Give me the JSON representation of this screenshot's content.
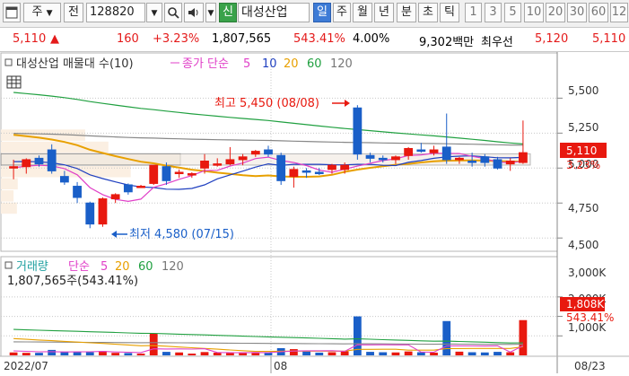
{
  "toolbar": {
    "window_icon": "window-icon",
    "market_label": "주",
    "jeon_label": "전",
    "code_value": "128820",
    "sin_label": "신",
    "company_name": "대성산업",
    "period_tabs": [
      "일",
      "주",
      "월",
      "년",
      "분",
      "초",
      "틱"
    ],
    "selected_period": "일",
    "interval_buttons": [
      "1",
      "3",
      "5",
      "10",
      "20",
      "30",
      "60",
      "12"
    ]
  },
  "quote": {
    "price": "5,110",
    "change_arrow": "▲",
    "change": "160",
    "change_pct": "+3.23%",
    "volume": "1,807,565",
    "volume_ratio": "543.41%",
    "rate": "4.00%",
    "amount": "9,302백만",
    "best_ask_label": "최우선",
    "best_ask": "5,120",
    "best_bid": "5,110"
  },
  "price_panel": {
    "legend_title": "대성산업 매물대 수(10)",
    "legend_ma": "종가 단순",
    "legend_periods": [
      "5",
      "10",
      "20",
      "60",
      "120"
    ],
    "high_label": "최고 5,450 (08/08)",
    "low_label": "최저 4,580 (07/15)",
    "y_ticks": [
      "5,500",
      "5,250",
      "5,000",
      "4,750",
      "4,500"
    ],
    "current_price_tag": "5,110",
    "current_pct_tag": "3.23%"
  },
  "volume_panel": {
    "legend_title": "거래량",
    "legend_ma": "단순",
    "legend_periods": [
      "5",
      "20",
      "60",
      "120"
    ],
    "volume_text": "1,807,565주(543.41%)",
    "y_ticks": [
      "3,000K",
      "2,000K",
      "1,000K"
    ],
    "current_volume_tag": "1,808K",
    "current_pct_tag": "543.41%"
  },
  "x_axis": {
    "labels": [
      "2022/07",
      "08",
      "08/23"
    ]
  },
  "colors": {
    "up": "#e8190f",
    "down": "#1a5fc8",
    "ma5": "#e040c8",
    "ma10": "#2040c0",
    "ma20": "#e8a000",
    "ma60": "#20a040",
    "ma120": "#888888",
    "tag_bg": "#e8190f",
    "grid": "#c8c8c8"
  },
  "chart_data": {
    "type": "candlestick",
    "price_axis": {
      "ylim": [
        4450,
        5650
      ],
      "ticks": [
        4500,
        4750,
        5000,
        5250,
        5500
      ]
    },
    "volume_axis": {
      "ylim": [
        0,
        3500
      ],
      "unit": "K",
      "ticks": [
        1000,
        2000,
        3000
      ]
    },
    "candles": [
      {
        "o": 5000,
        "h": 5060,
        "l": 4920,
        "c": 5010,
        "v": 150
      },
      {
        "o": 5010,
        "h": 5070,
        "l": 4960,
        "c": 5060,
        "v": 130
      },
      {
        "o": 5070,
        "h": 5090,
        "l": 5010,
        "c": 5030,
        "v": 130
      },
      {
        "o": 5130,
        "h": 5170,
        "l": 4960,
        "c": 4980,
        "v": 280
      },
      {
        "o": 4940,
        "h": 4980,
        "l": 4880,
        "c": 4900,
        "v": 190
      },
      {
        "o": 4870,
        "h": 4900,
        "l": 4750,
        "c": 4790,
        "v": 170
      },
      {
        "o": 4750,
        "h": 4760,
        "l": 4570,
        "c": 4600,
        "v": 160
      },
      {
        "o": 4600,
        "h": 4790,
        "l": 4580,
        "c": 4780,
        "v": 220
      },
      {
        "o": 4780,
        "h": 4820,
        "l": 4750,
        "c": 4810,
        "v": 130
      },
      {
        "o": 4880,
        "h": 4890,
        "l": 4810,
        "c": 4830,
        "v": 120
      },
      {
        "o": 4870,
        "h": 4880,
        "l": 4860,
        "c": 4870,
        "v": 90
      },
      {
        "o": 4890,
        "h": 5020,
        "l": 4880,
        "c": 5020,
        "v": 1110
      },
      {
        "o": 5010,
        "h": 5040,
        "l": 4880,
        "c": 4910,
        "v": 180
      },
      {
        "o": 4960,
        "h": 4990,
        "l": 4930,
        "c": 4970,
        "v": 150
      },
      {
        "o": 4950,
        "h": 4970,
        "l": 4930,
        "c": 4960,
        "v": 90
      },
      {
        "o": 5000,
        "h": 5100,
        "l": 4960,
        "c": 5050,
        "v": 170
      },
      {
        "o": 5020,
        "h": 5070,
        "l": 5010,
        "c": 5030,
        "v": 140
      },
      {
        "o": 5030,
        "h": 5150,
        "l": 5020,
        "c": 5060,
        "v": 150
      },
      {
        "o": 5060,
        "h": 5100,
        "l": 5020,
        "c": 5080,
        "v": 120
      },
      {
        "o": 5100,
        "h": 5130,
        "l": 5080,
        "c": 5120,
        "v": 150
      },
      {
        "o": 5130,
        "h": 5160,
        "l": 5080,
        "c": 5100,
        "v": 140
      },
      {
        "o": 5090,
        "h": 5110,
        "l": 4880,
        "c": 4910,
        "v": 370
      },
      {
        "o": 4940,
        "h": 5010,
        "l": 4860,
        "c": 4990,
        "v": 320
      },
      {
        "o": 4980,
        "h": 5000,
        "l": 4930,
        "c": 4970,
        "v": 200
      },
      {
        "o": 4970,
        "h": 5000,
        "l": 4950,
        "c": 4960,
        "v": 140
      },
      {
        "o": 4990,
        "h": 5030,
        "l": 4960,
        "c": 5020,
        "v": 160
      },
      {
        "o": 4990,
        "h": 5040,
        "l": 4960,
        "c": 5020,
        "v": 210
      },
      {
        "o": 5430,
        "h": 5450,
        "l": 5060,
        "c": 5100,
        "v": 2000
      },
      {
        "o": 5090,
        "h": 5110,
        "l": 5040,
        "c": 5070,
        "v": 180
      },
      {
        "o": 5070,
        "h": 5090,
        "l": 5040,
        "c": 5060,
        "v": 160
      },
      {
        "o": 5060,
        "h": 5090,
        "l": 5030,
        "c": 5080,
        "v": 150
      },
      {
        "o": 5090,
        "h": 5150,
        "l": 5060,
        "c": 5140,
        "v": 200
      },
      {
        "o": 5130,
        "h": 5180,
        "l": 5110,
        "c": 5120,
        "v": 160
      },
      {
        "o": 5110,
        "h": 5160,
        "l": 5090,
        "c": 5130,
        "v": 140
      },
      {
        "o": 5150,
        "h": 5390,
        "l": 5030,
        "c": 5060,
        "v": 1760
      },
      {
        "o": 5060,
        "h": 5080,
        "l": 5030,
        "c": 5070,
        "v": 190
      },
      {
        "o": 5050,
        "h": 5110,
        "l": 5010,
        "c": 5040,
        "v": 160
      },
      {
        "o": 5080,
        "h": 5100,
        "l": 5010,
        "c": 5040,
        "v": 150
      },
      {
        "o": 5060,
        "h": 5080,
        "l": 4990,
        "c": 5000,
        "v": 180
      },
      {
        "o": 5030,
        "h": 5070,
        "l": 4980,
        "c": 5050,
        "v": 160
      },
      {
        "o": 5040,
        "h": 5340,
        "l": 5030,
        "c": 5110,
        "v": 1808
      }
    ]
  }
}
